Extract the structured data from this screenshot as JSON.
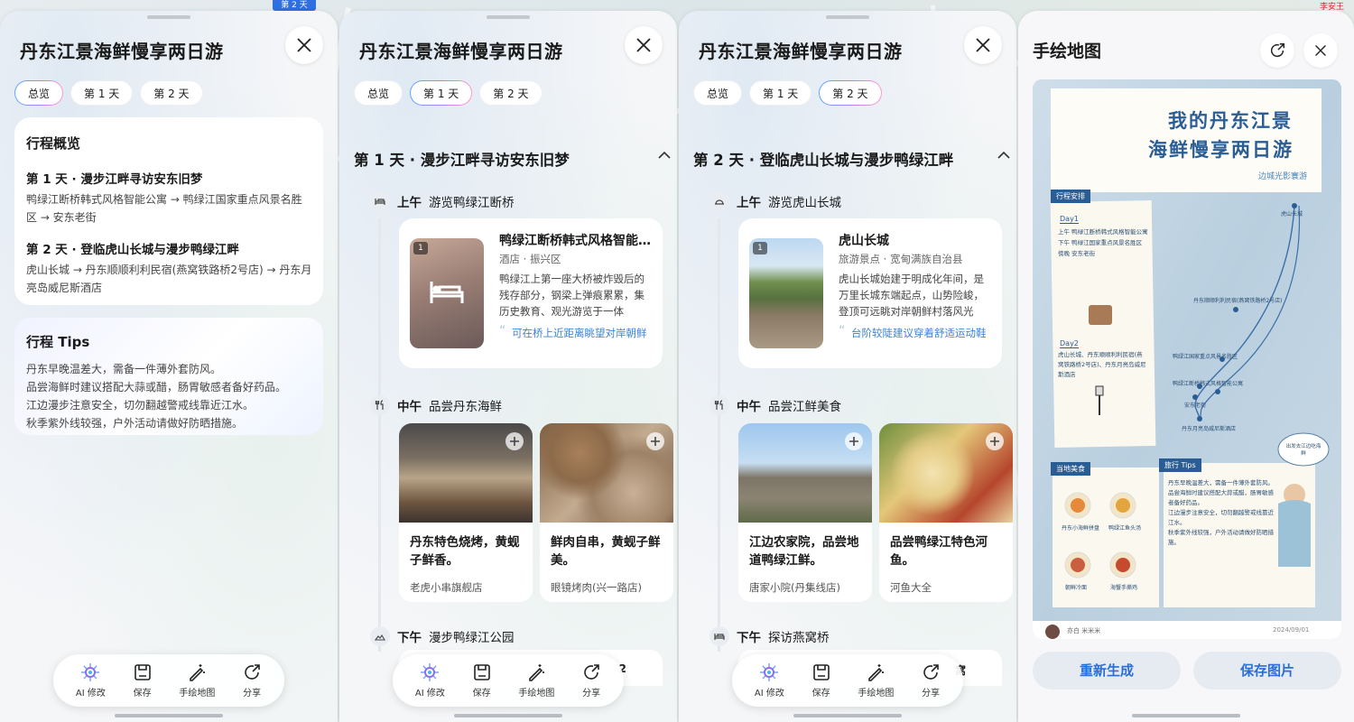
{
  "map": {
    "badge": "第 2 天",
    "corner_text": "李安王"
  },
  "trip_title": "丹东江景海鲜慢享两日游",
  "tabs": [
    "总览",
    "第 1 天",
    "第 2 天"
  ],
  "overview": {
    "heading": "行程概览",
    "days": [
      {
        "title": "第 1 天 · 漫步江畔寻访安东旧梦",
        "route": "鸭绿江断桥韩式风格智能公寓 → 鸭绿江国家重点风景名胜区 → 安东老街"
      },
      {
        "title": "第 2 天 · 登临虎山长城与漫步鸭绿江畔",
        "route": "虎山长城 → 丹东顺顺利利民宿(燕窝铁路桥2号店) → 丹东月亮岛威尼斯酒店"
      }
    ],
    "tips_heading": "行程 Tips",
    "tips": [
      "丹东早晚温差大，需备一件薄外套防风。",
      "品尝海鲜时建议搭配大蒜或醋，肠胃敏感者备好药品。",
      "江边漫步注意安全，切勿翻越警戒线靠近江水。",
      "秋季紫外线较强，户外活动请做好防晒措施。"
    ]
  },
  "day1": {
    "title": "第 1 天 · 漫步江畔寻访安东旧梦",
    "slots": [
      {
        "time": "上午",
        "label": "游览鸭绿江断桥"
      },
      {
        "time": "中午",
        "label": "品尝丹东海鲜"
      },
      {
        "time": "下午",
        "label": "漫步鸭绿江公园"
      }
    ],
    "poi": {
      "num": "1",
      "name": "鸭绿江断桥韩式风格智能公寓",
      "cat": "酒店 · 振兴区",
      "desc": "鸭绿江上第一座大桥被炸毁后的残存部分，钢梁上弹痕累累，集历史教育、观光游览于一体",
      "tip": "可在桥上近距离眺望对岸朝鲜"
    },
    "foods": [
      {
        "title": "丹东特色烧烤，黄蚬子鲜香。",
        "shop": "老虎小串旗舰店"
      },
      {
        "title": "鲜肉自串，黄蚬子鲜美。",
        "shop": "眼镜烤肉(兴一路店)"
      }
    ],
    "next_partial": "2"
  },
  "day2": {
    "title": "第 2 天 · 登临虎山长城与漫步鸭绿江畔",
    "slots": [
      {
        "time": "上午",
        "label": "游览虎山长城"
      },
      {
        "time": "中午",
        "label": "品尝江鲜美食"
      },
      {
        "time": "下午",
        "label": "探访燕窝桥"
      }
    ],
    "poi": {
      "num": "1",
      "name": "虎山长城",
      "cat": "旅游景点 · 宽甸满族自治县",
      "desc": "虎山长城始建于明成化年间，是万里长城东端起点，山势险峻，登顶可远眺对岸朝鲜村落风光",
      "tip": "台阶较陡建议穿着舒适运动鞋"
    },
    "foods": [
      {
        "title": "江边农家院，品尝地道鸭绿江鲜。",
        "shop": "唐家小院(丹集线店)"
      },
      {
        "title": "品尝鸭绿江特色河鱼。",
        "shop": "河鱼大全"
      }
    ],
    "next_partial": "窝"
  },
  "toolbar": {
    "ai": "AI 修改",
    "save": "保存",
    "handmap": "手绘地图",
    "share": "分享"
  },
  "hand_map_panel": {
    "title": "手绘地图",
    "map_title_1": "我的丹东江景",
    "map_title_2": "海鲜慢享两日游",
    "map_subtitle": "边城光影寰游",
    "itinerary_tag": "行程安排",
    "day1_tag": "Day1",
    "day1_items": [
      "上午  鸭绿江断桥韩式风格智能公寓",
      "下午  鸭绿江国家重点风景名胜区",
      "傍晚  安东老街"
    ],
    "day2_tag": "Day2",
    "day2_items": [
      "虎山长城、丹东顺顺利利民宿(燕窝铁路桥2号店)、丹东月亮岛威尼斯酒店"
    ],
    "map_labels": [
      "虎山长城",
      "丹东顺顺利利民宿(燕窝铁路桥2号店)",
      "鸭绿江国家重点风景名胜区",
      "鸭绿江断桥韩式风格智能公寓",
      "安东老街",
      "丹东月亮岛威尼斯酒店"
    ],
    "food_tag": "当地美食",
    "food_items": [
      "丹东小海鲜拼盘",
      "鸭绿江鱼头汤",
      "朝鲜冷面",
      "海蟹手撕鸡"
    ],
    "tips_tag": "旅行 Tips",
    "tips_items": [
      "丹东早晚温差大，需备一件薄外套防风。",
      "品尝海鲜时建议搭配大蒜或醋，肠胃敏感者备好药品。",
      "江边漫步注意安全，切勿翻越警戒线靠近江水。",
      "秋季紫外线较强，户外活动请做好防晒措施。"
    ],
    "bubble": "出发去江边吃海鲜",
    "author": "亦白 米米米",
    "date": "2024/09/01",
    "regen": "重新生成",
    "save_img": "保存图片"
  }
}
